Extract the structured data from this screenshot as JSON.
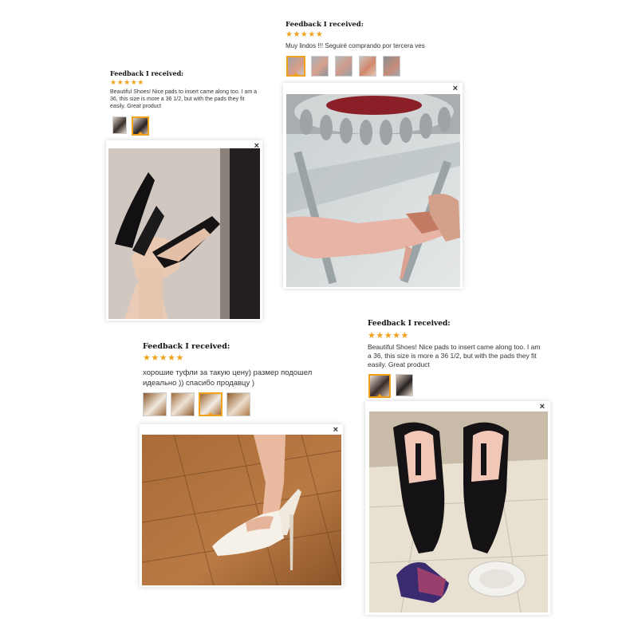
{
  "cards": [
    {
      "header": "Feedback I received:",
      "stars": "★★★★★",
      "text": "Beautiful Shoes! Nice pads to insert came along too. I am a 36, this size is more a 36 1/2, but with the pads they fit easily. Great product",
      "close": "×"
    },
    {
      "header": "Feedback I received:",
      "stars": "★★★★★",
      "text": "Muy lindos !!! Seguiré comprando por tercera ves",
      "close": "×"
    },
    {
      "header": "Feedback I received:",
      "stars": "★★★★★",
      "text": "хорошие туфли за такую цену) размер подошел идеально )) спасибо продавцу )",
      "close": "×"
    },
    {
      "header": "Feedback I received:",
      "stars": "★★★★★",
      "text": "Beautiful Shoes! Nice pads to insert came along too. I am a 36, this size is more a 36 1/2, but with the pads they fit easily. Great product",
      "close": "×"
    }
  ],
  "icons": {
    "close": "close-icon",
    "star": "star-icon"
  },
  "colors": {
    "star": "#f0a21a",
    "selected_border": "#f0a21a"
  }
}
